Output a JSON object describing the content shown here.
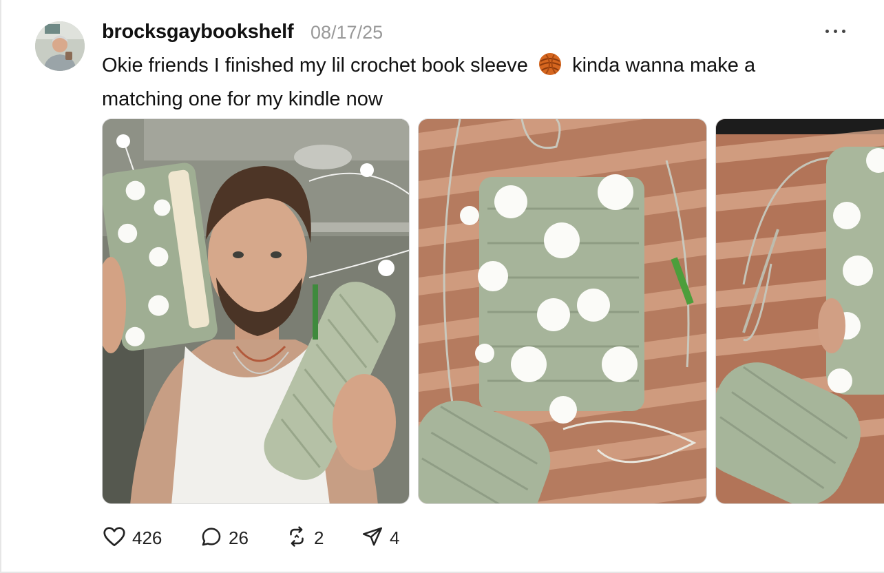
{
  "post": {
    "username": "brocksgaybookshelf",
    "date": "08/17/25",
    "text_before_emoji": "Okie friends I finished my lil crochet book sleeve",
    "emoji": "yarn-emoji",
    "text_after_emoji": "kinda wanna make a matching one for my kindle now"
  },
  "images": [
    {
      "subject": "man holding crochet book sleeve and yarn"
    },
    {
      "subject": "green crochet book sleeve with white flowers"
    },
    {
      "subject": "crochet sleeve and yarn on wooden table"
    }
  ],
  "actions": {
    "likes": "426",
    "comments": "26",
    "reposts": "2",
    "shares": "4"
  },
  "icons": [
    "more-icon",
    "heart-icon",
    "comment-icon",
    "repost-icon",
    "share-icon"
  ],
  "colors": {
    "text": "#111111",
    "muted": "#999999",
    "yarn_green": "#a9b99c",
    "table_wood": "#b47a5e"
  }
}
